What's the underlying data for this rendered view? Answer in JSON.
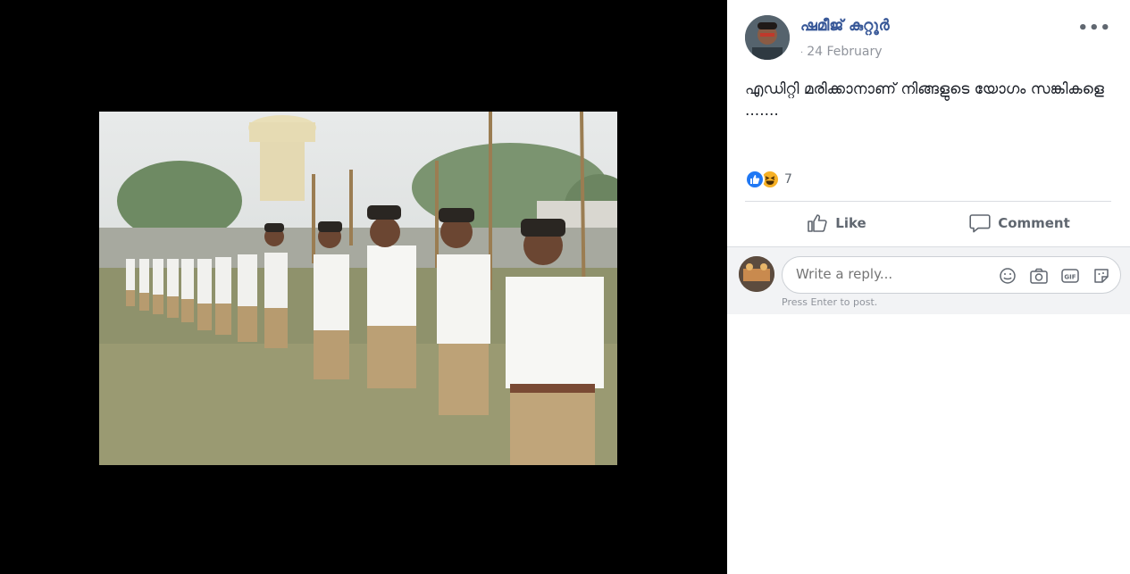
{
  "post": {
    "author": "ഷമീജ് കുറ്റൂർ",
    "date": "24 February",
    "date_separator": "·",
    "more_label": "•••",
    "text": "എഡിറ്റി മരിക്കാനാണ് നിങ്ങളുടെ യോഗം സങ്കികളെ .......",
    "reaction_count": "7",
    "reactions": [
      "like",
      "haha"
    ]
  },
  "actions": {
    "like_label": "Like",
    "comment_label": "Comment"
  },
  "reply": {
    "placeholder": "Write a reply...",
    "hint": "Press Enter to post.",
    "icons": [
      "emoji-icon",
      "camera-icon",
      "gif-icon",
      "sticker-icon"
    ]
  },
  "colors": {
    "link": "#385898",
    "like_blue": "#2078f4",
    "haha_yellow": "#f7b125"
  }
}
